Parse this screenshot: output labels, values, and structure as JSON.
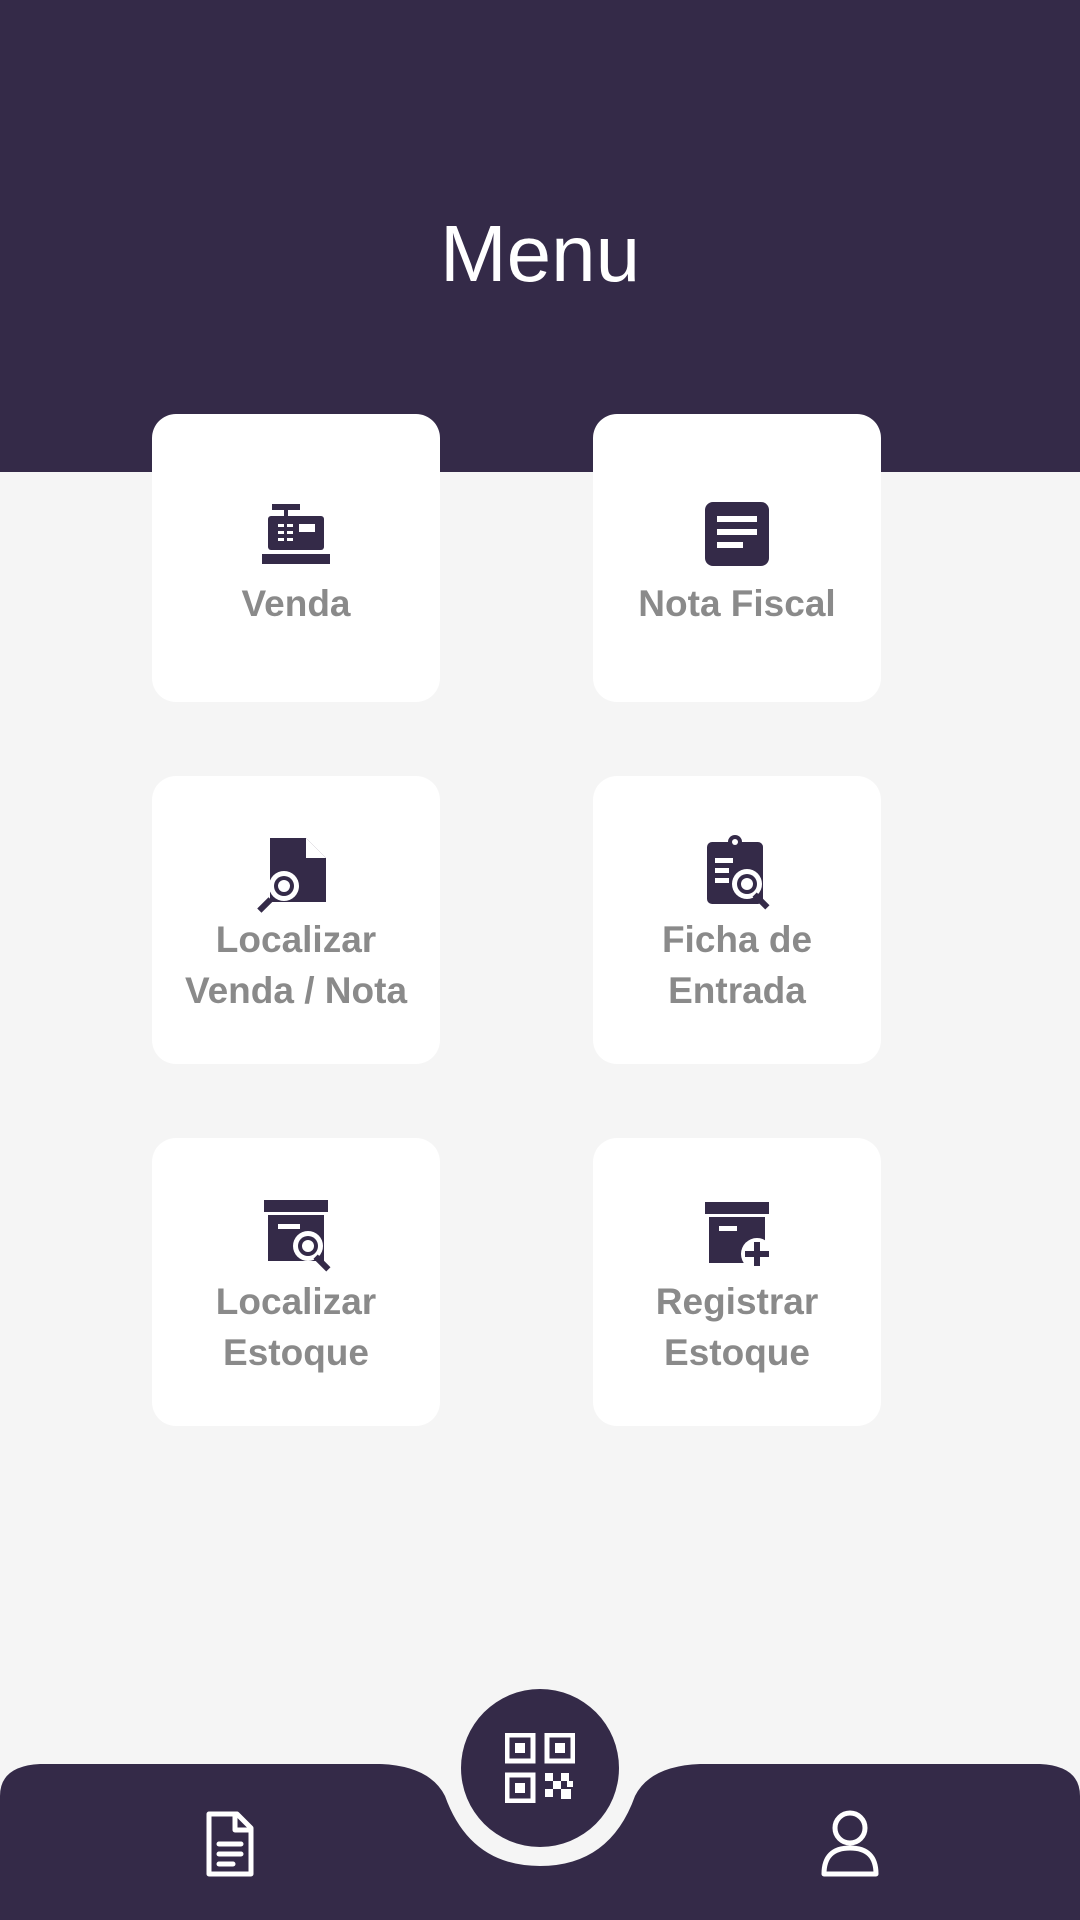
{
  "header": {
    "title": "Menu"
  },
  "cards": [
    {
      "label": "Venda",
      "icon": "cash-register-icon"
    },
    {
      "label": "Nota Fiscal",
      "icon": "document-icon"
    },
    {
      "label_line1": "Localizar",
      "label_line2": "Venda / Nota",
      "icon": "file-search-icon"
    },
    {
      "label_line1": "Ficha de",
      "label_line2": "Entrada",
      "icon": "clipboard-search-icon"
    },
    {
      "label_line1": "Localizar",
      "label_line2": "Estoque",
      "icon": "archive-search-icon"
    },
    {
      "label_line1": "Registrar",
      "label_line2": "Estoque",
      "icon": "archive-add-icon"
    }
  ],
  "bottom_nav": {
    "left_icon": "document-outline-icon",
    "center_icon": "qr-code-icon",
    "right_icon": "user-outline-icon"
  },
  "colors": {
    "primary": "#342a48",
    "background": "#f5f5f5",
    "card": "#ffffff",
    "label": "#8a8a8a"
  }
}
